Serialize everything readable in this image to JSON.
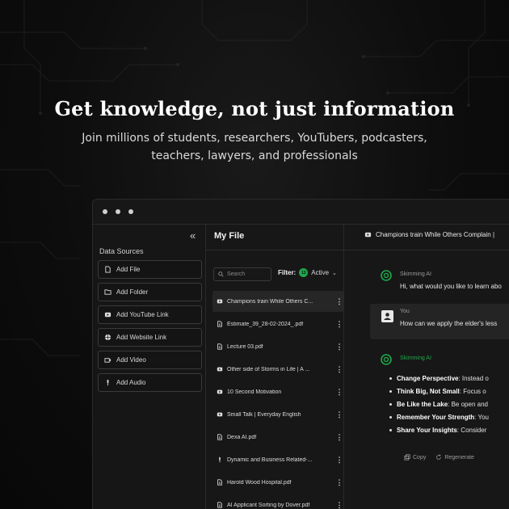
{
  "hero": {
    "title": "Get knowledge, not just information",
    "subtitle_line1": "Join millions of students, researchers, YouTubers, podcasters,",
    "subtitle_line2": "teachers, lawyers, and professionals"
  },
  "sidebar": {
    "collapse_icon": "double-chevron-left-icon",
    "section_label": "Data Sources",
    "buttons": [
      {
        "label": "Add File",
        "icon": "file-icon"
      },
      {
        "label": "Add Folder",
        "icon": "folder-icon"
      },
      {
        "label": "Add YouTube Link",
        "icon": "youtube-icon"
      },
      {
        "label": "Add Website Link",
        "icon": "globe-icon"
      },
      {
        "label": "Add Video",
        "icon": "video-icon"
      },
      {
        "label": "Add Audio",
        "icon": "microphone-icon"
      }
    ]
  },
  "file_panel": {
    "title": "My File",
    "search_placeholder": "Search",
    "filter_label": "Filter:",
    "filter_count": "13",
    "filter_value": "Active",
    "files": [
      {
        "name": "Champions train While Others C...",
        "icon": "youtube-icon",
        "selected": true
      },
      {
        "name": "Estimate_39_28-02-2024_.pdf",
        "icon": "file-icon"
      },
      {
        "name": "Lecture 03.pdf",
        "icon": "file-icon"
      },
      {
        "name": "Other side of Storms in Life | A ...",
        "icon": "youtube-icon"
      },
      {
        "name": "10 Second Motivation",
        "icon": "youtube-icon"
      },
      {
        "name": "Small Talk | Everyday English",
        "icon": "youtube-icon"
      },
      {
        "name": "Dexa AI.pdf",
        "icon": "file-icon"
      },
      {
        "name": "Dynamic and Business Related-...",
        "icon": "microphone-icon"
      },
      {
        "name": "Harold Wood Hospital.pdf",
        "icon": "file-icon"
      },
      {
        "name": "AI Applicant Sorting by Dover.pdf",
        "icon": "file-icon"
      }
    ]
  },
  "chat": {
    "title": "Champions train While Others Complain |",
    "ai_name": "Skimming AI",
    "greeting": "Hi, what would you like to learn abo",
    "user_name": "You",
    "user_message": "How can we apply the elder's less",
    "bullets": [
      {
        "bold": "Change Perspective",
        "text": ": Instead o"
      },
      {
        "bold": "Think Big, Not Small",
        "text": ": Focus o"
      },
      {
        "bold": "Be Like the Lake",
        "text": ": Be open and"
      },
      {
        "bold": "Remember Your Strength",
        "text": ": You"
      },
      {
        "bold": "Share Your Insights",
        "text": ": Consider"
      }
    ],
    "copy_label": "Copy",
    "regenerate_label": "Regenerate"
  },
  "colors": {
    "accent_green": "#1ea84a",
    "background": "#0b0b0b",
    "panel": "#171717"
  }
}
